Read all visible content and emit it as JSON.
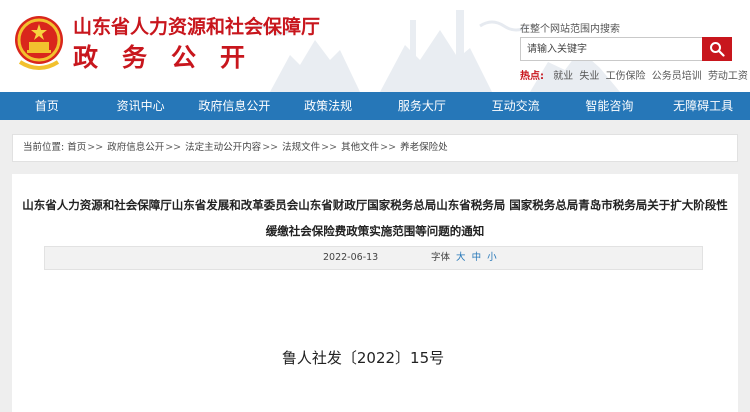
{
  "header": {
    "title_main": "山东省人力资源和社会保障厅",
    "title_sub": "政务公开",
    "brand_color": "#c8161d"
  },
  "search": {
    "caption": "在整个网站范围内搜索",
    "placeholder": "请输入关键字",
    "button_icon": "search-icon",
    "hot_label": "热点:",
    "hot_words": [
      "就业",
      "失业",
      "工伤保险",
      "公务员培训",
      "劳动工资"
    ]
  },
  "nav": {
    "color": "#2677b8",
    "items": [
      "首页",
      "资讯中心",
      "政府信息公开",
      "政策法规",
      "服务大厅",
      "互动交流",
      "智能咨询",
      "无障碍工具"
    ]
  },
  "breadcrumb": {
    "label": "当前位置:",
    "items": [
      "首页",
      "政府信息公开",
      "法定主动公开内容",
      "法规文件",
      "其他文件",
      "养老保险处"
    ],
    "separator": ">>"
  },
  "article": {
    "title": "山东省人力资源和社会保障厅山东省发展和改革委员会山东省财政厅国家税务总局山东省税务局 国家税务总局青岛市税务局关于扩大阶段性缓缴社会保险费政策实施范围等问题的通知",
    "date": "2022-06-13",
    "font_label": "字体",
    "font_sizes": [
      "大",
      "中",
      "小"
    ],
    "doc_number": "鲁人社发〔2022〕15号"
  }
}
